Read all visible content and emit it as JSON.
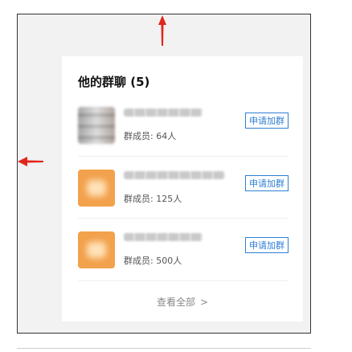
{
  "card": {
    "title": "他的群聊 (5)",
    "groups": [
      {
        "members_label": "群成员: 64人",
        "join_label": "申请加群"
      },
      {
        "members_label": "群成员: 125人",
        "join_label": "申请加群"
      },
      {
        "members_label": "群成员: 500人",
        "join_label": "申请加群"
      }
    ],
    "view_all": {
      "label": "查看全部",
      "chevron": ">"
    }
  },
  "colors": {
    "accent": "#2f7fd3",
    "annotation_arrow": "#e0261b",
    "avatar_orange": "#f2a14c"
  },
  "icons": {
    "annotation_up": "arrow-up-icon",
    "annotation_left": "arrow-left-icon",
    "view_all": "chevron-right-icon"
  }
}
